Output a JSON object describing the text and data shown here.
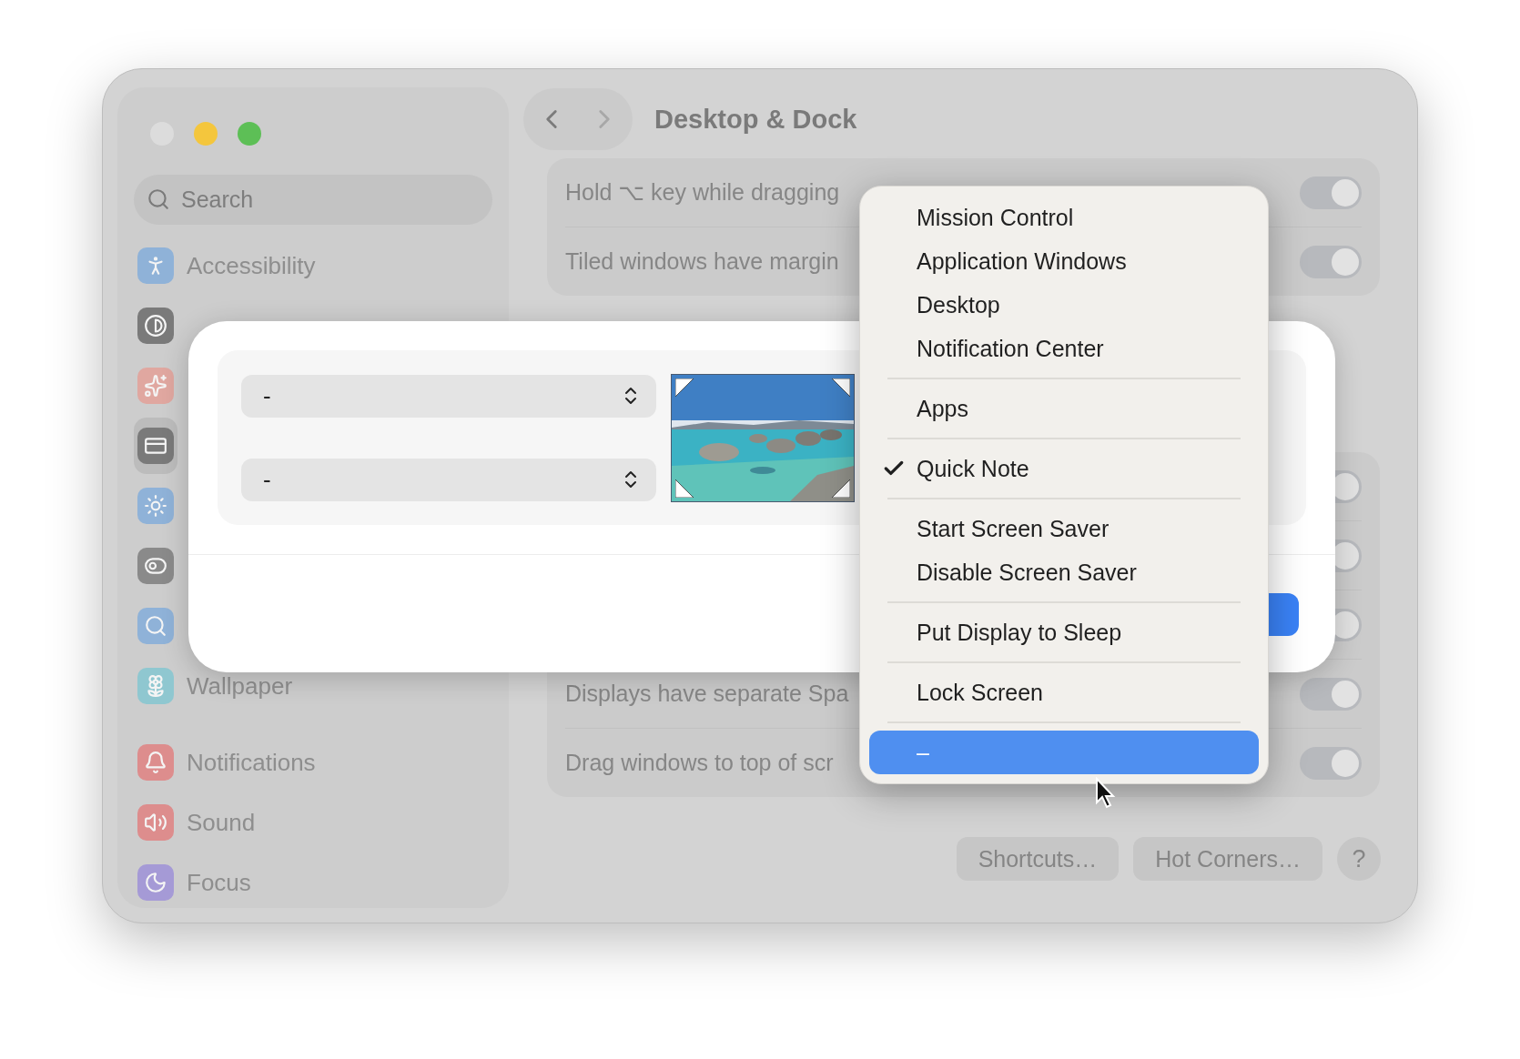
{
  "window": {
    "title": "Desktop & Dock",
    "traffic_lights": [
      {
        "color": "#dcdcdc"
      },
      {
        "color": "#f4c63d"
      },
      {
        "color": "#5dbf56"
      }
    ]
  },
  "sidebar": {
    "search": {
      "placeholder": "Search"
    },
    "items": [
      {
        "label": "Accessibility",
        "color": "#8fb2d8",
        "selected": false
      },
      {
        "color": "#7a7a7a",
        "selected": false
      },
      {
        "color": "#e0a7a0",
        "selected": false
      },
      {
        "color": "#7a7a7a",
        "selected": true
      },
      {
        "color": "#8fb2d8",
        "selected": false
      },
      {
        "color": "#8a8a8a",
        "selected": false
      },
      {
        "color": "#8fb2d8",
        "selected": false
      },
      {
        "label": "Wallpaper",
        "color": "#8fc7d0",
        "selected": false
      },
      {
        "label": "Notifications",
        "color": "#dd8d8d",
        "selected": false
      },
      {
        "label": "Sound",
        "color": "#dd8d8d",
        "selected": false
      },
      {
        "label": "Focus",
        "color": "#a59ad6",
        "selected": false
      }
    ]
  },
  "groups": [
    {
      "rows": [
        {
          "label": "Hold ⌥ key while dragging",
          "on": true
        },
        {
          "label": "Tiled windows have margin",
          "on": true
        }
      ]
    },
    {
      "rows": [
        {
          "on": true
        },
        {
          "on": true
        },
        {
          "on": true
        },
        {
          "label": "Displays have separate Spa",
          "on": true
        },
        {
          "label": "Drag windows to top of scr",
          "on": true
        }
      ]
    }
  ],
  "footer_buttons": [
    "Shortcuts…",
    "Hot Corners…",
    "?"
  ],
  "dialog": {
    "corner_selects": [
      {
        "value": "-"
      },
      {
        "value": "-"
      }
    ]
  },
  "menu": {
    "items": [
      {
        "kind": "item",
        "label": "Mission Control",
        "checked": false,
        "selected": false
      },
      {
        "kind": "item",
        "label": "Application Windows",
        "checked": false,
        "selected": false
      },
      {
        "kind": "item",
        "label": "Desktop",
        "checked": false,
        "selected": false
      },
      {
        "kind": "item",
        "label": "Notification Center",
        "checked": false,
        "selected": false
      },
      {
        "kind": "separator"
      },
      {
        "kind": "item",
        "label": "Apps",
        "checked": false,
        "selected": false
      },
      {
        "kind": "separator"
      },
      {
        "kind": "item",
        "label": "Quick Note",
        "checked": true,
        "selected": false
      },
      {
        "kind": "separator"
      },
      {
        "kind": "item",
        "label": "Start Screen Saver",
        "checked": false,
        "selected": false
      },
      {
        "kind": "item",
        "label": "Disable Screen Saver",
        "checked": false,
        "selected": false
      },
      {
        "kind": "separator"
      },
      {
        "kind": "item",
        "label": "Put Display to Sleep",
        "checked": false,
        "selected": false
      },
      {
        "kind": "separator"
      },
      {
        "kind": "item",
        "label": "Lock Screen",
        "checked": false,
        "selected": false
      },
      {
        "kind": "separator"
      },
      {
        "kind": "item",
        "label": "–",
        "checked": false,
        "selected": true
      }
    ]
  }
}
